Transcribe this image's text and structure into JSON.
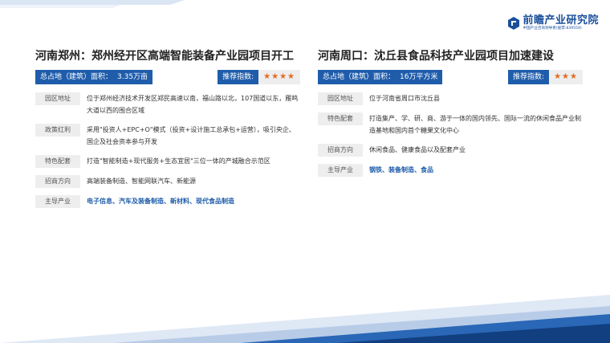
{
  "logo": {
    "name": "前瞻产业研究院",
    "subtitle": "中国产业咨询领导者(股票:839559)"
  },
  "colors": {
    "brand_blue": "#1f5dab",
    "star_orange": "#e46a22",
    "tag_grey": "#eeeeee"
  },
  "projects": [
    {
      "title": "河南郑州：郑州经开区高端智能装备产业园项目开工",
      "area_label": "总占地（建筑）面积：",
      "area_value": "3.35万亩",
      "rating_label": "推荐指数:",
      "stars": "★★★★",
      "rows": [
        {
          "tag": "园区地址",
          "value": "位于郑州经济技术开发区郑民高速以南，福山路以北，107国道以东，雁鸣大道以西的围合区域"
        },
        {
          "tag": "政策红利",
          "value": "采用\"投资人+EPC+O\"模式（投资+设计施工总承包+运营），吸引央企、国企及社会资本参与开发"
        },
        {
          "tag": "特色配套",
          "value": "打造\"智能制造+现代服务+生态宜居\"三位一体的产城融合示范区"
        },
        {
          "tag": "招商方向",
          "value": "高端装备制造、智能网联汽车、新能源"
        },
        {
          "tag": "主导产业",
          "value": "电子信息、汽车及装备制造、新材料、现代食品制造"
        }
      ]
    },
    {
      "title": "河南周口：沈丘县食品科技产业园项目加速建设",
      "area_label": "总占地（建筑）面积：",
      "area_value": "16万平方米",
      "rating_label": "推荐指数:",
      "stars": "★★★",
      "rows": [
        {
          "tag": "园区地址",
          "value": "位于河南省周口市沈丘县"
        },
        {
          "tag": "特色配套",
          "value": "打造集产、学、研、商、游于一体的国内领先、国际一流的休闲食品产业制造基地和国内首个糖果文化中心"
        },
        {
          "tag": "招商方向",
          "value": "休闲食品、健康食品以及配套产业"
        },
        {
          "tag": "主导产业",
          "value": "钢铁、装备制造、食品"
        }
      ]
    }
  ]
}
